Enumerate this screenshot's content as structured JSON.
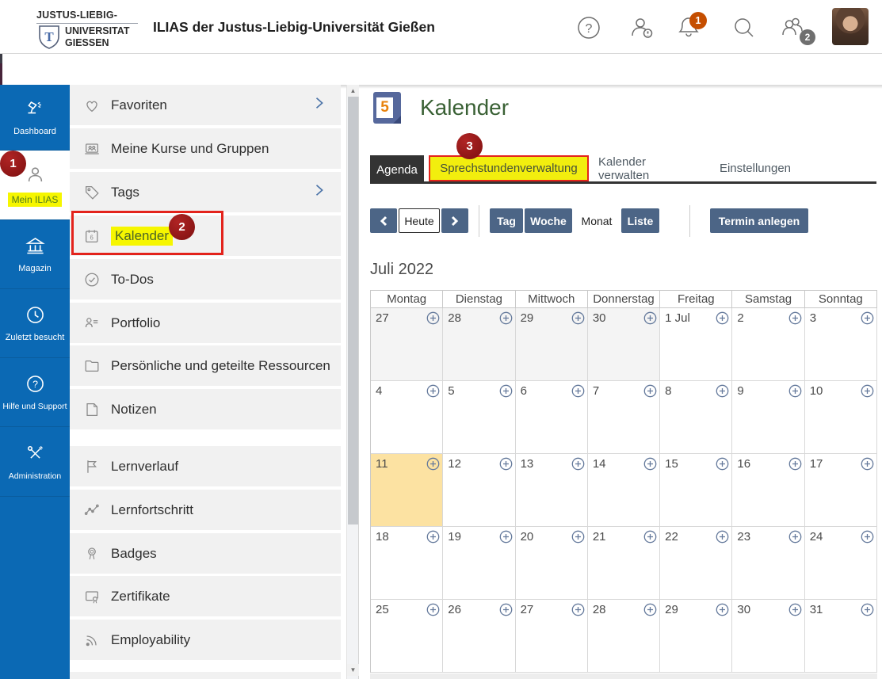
{
  "header": {
    "logo": {
      "line1": "JUSTUS-LIEBIG-",
      "line2": "UNIVERSITAT",
      "line3": "GIESSEN",
      "shield_letter": "T"
    },
    "title": "ILIAS der Justus-Liebig-Universität Gießen",
    "icons": [
      "help-icon",
      "contact-awareness-icon",
      "notifications-bell-icon",
      "search-icon",
      "online-users-icon",
      "user-avatar"
    ],
    "notification_badge": "1",
    "online_users_badge": "2"
  },
  "rail": {
    "items": [
      {
        "label": "Dashboard",
        "icon": "lamp-icon",
        "active": false
      },
      {
        "label": "Mein ILIAS",
        "icon": "person-icon",
        "active": true
      },
      {
        "label": "Magazin",
        "icon": "bank-icon",
        "active": false
      },
      {
        "label": "Zuletzt besucht",
        "icon": "clock-icon",
        "active": false
      },
      {
        "label": "Hilfe und Support",
        "icon": "question-icon",
        "active": false
      },
      {
        "label": "Administration",
        "icon": "tools-icon",
        "active": false
      }
    ]
  },
  "menu": {
    "items": [
      {
        "label": "Favoriten",
        "icon": "heart-icon",
        "chevron": true
      },
      {
        "label": "Meine Kurse und Gruppen",
        "icon": "courses-icon",
        "chevron": false
      },
      {
        "label": "Tags",
        "icon": "tag-icon",
        "chevron": true
      },
      {
        "label": "Kalender",
        "icon": "calendar-icon",
        "chevron": false,
        "highlighted": true
      },
      {
        "label": "To-Dos",
        "icon": "check-circle-icon",
        "chevron": false
      },
      {
        "label": "Portfolio",
        "icon": "portfolio-icon",
        "chevron": false
      },
      {
        "label": "Persönliche und geteilte Ressourcen",
        "icon": "folder-icon",
        "chevron": false
      },
      {
        "label": "Notizen",
        "icon": "note-icon",
        "chevron": false
      },
      {
        "label": "Lernverlauf",
        "icon": "flag-icon",
        "chevron": false
      },
      {
        "label": "Lernfortschritt",
        "icon": "chart-icon",
        "chevron": false
      },
      {
        "label": "Badges",
        "icon": "medal-icon",
        "chevron": false
      },
      {
        "label": "Zertifikate",
        "icon": "certificate-icon",
        "chevron": false
      },
      {
        "label": "Employability",
        "icon": "rss-icon",
        "chevron": false
      }
    ]
  },
  "main": {
    "page_title": "Kalender",
    "page_icon_number": "5",
    "tabs": [
      {
        "label": "Agenda",
        "active": true
      },
      {
        "label": "Sprechstundenverwaltung",
        "highlighted": true
      },
      {
        "label": "Kalender verwalten"
      },
      {
        "label": "Einstellungen"
      }
    ],
    "toolbar": {
      "prev_icon": "chevron-left-icon",
      "today_label": "Heute",
      "next_icon": "chevron-right-icon",
      "views": [
        "Tag",
        "Woche",
        "Monat",
        "Liste"
      ],
      "active_view": "Monat",
      "create_label": "Termin anlegen"
    },
    "month_title": "Juli 2022",
    "calendar": {
      "day_headers": [
        "Montag",
        "Dienstag",
        "Mittwoch",
        "Donnerstag",
        "Freitag",
        "Samstag",
        "Sonntag"
      ],
      "cells": [
        {
          "label": "27",
          "other": true
        },
        {
          "label": "28",
          "other": true
        },
        {
          "label": "29",
          "other": true
        },
        {
          "label": "30",
          "other": true
        },
        {
          "label": "1 Jul"
        },
        {
          "label": "2"
        },
        {
          "label": "3"
        },
        {
          "label": "4"
        },
        {
          "label": "5"
        },
        {
          "label": "6"
        },
        {
          "label": "7"
        },
        {
          "label": "8"
        },
        {
          "label": "9"
        },
        {
          "label": "10"
        },
        {
          "label": "11",
          "today": true
        },
        {
          "label": "12"
        },
        {
          "label": "13"
        },
        {
          "label": "14"
        },
        {
          "label": "15"
        },
        {
          "label": "16"
        },
        {
          "label": "17"
        },
        {
          "label": "18"
        },
        {
          "label": "19"
        },
        {
          "label": "20"
        },
        {
          "label": "21"
        },
        {
          "label": "22"
        },
        {
          "label": "23"
        },
        {
          "label": "24"
        },
        {
          "label": "25"
        },
        {
          "label": "26"
        },
        {
          "label": "27"
        },
        {
          "label": "28"
        },
        {
          "label": "29"
        },
        {
          "label": "30"
        },
        {
          "label": "31"
        }
      ]
    }
  },
  "annotations": {
    "step1": "1",
    "step2": "2",
    "step3": "3"
  },
  "colors": {
    "rail_blue": "#0b69b4",
    "button_slate": "#4c6586",
    "annotation_red": "#9b1c1c",
    "red_box": "#e3231c",
    "highlight_yellow": "#f6f600",
    "today_cell": "#fce2a2",
    "title_green": "#3a6135",
    "notification_orange": "#c54e00",
    "badge_gray": "#6f6f6f",
    "active_tab_dark": "#333333"
  }
}
